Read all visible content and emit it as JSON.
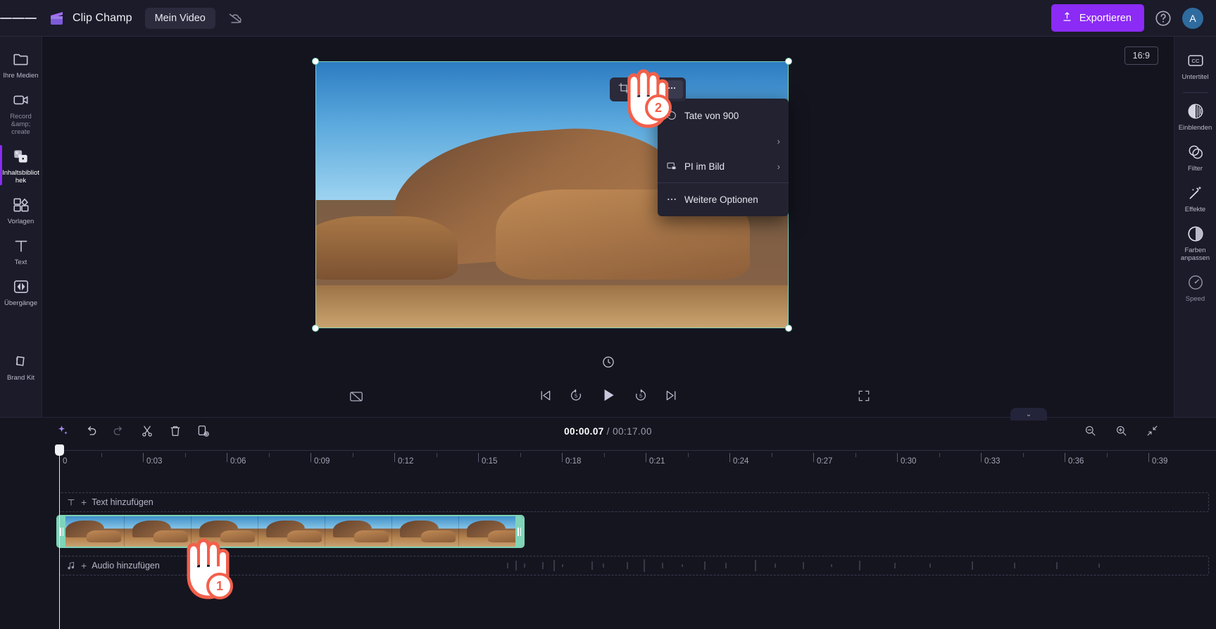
{
  "app": {
    "brand_name": "Clip Champ",
    "project_name": "Mein Video",
    "export_label": "Exportieren",
    "avatar_initial": "A",
    "accent_color": "#8B2BF5",
    "selection_color": "#7fd4b8",
    "annotation_color": "#F2604B"
  },
  "topbar": {
    "menu_icon": "hamburger-icon",
    "logo_icon": "clipchamp-logo-icon",
    "cloud_icon": "cloud-off-icon",
    "upload_icon": "upload-arrow-icon",
    "help_icon": "help-circle-icon"
  },
  "left_rail": {
    "items": [
      {
        "label": "Ihre Medien",
        "icon": "folder-icon",
        "active": false
      },
      {
        "label": "Record &amp; create",
        "icon": "video-camera-icon",
        "active": false
      },
      {
        "label": "Inhaltsbibliothek",
        "icon": "content-library-icon",
        "active": true
      },
      {
        "label": "Vorlagen",
        "icon": "templates-grid-icon",
        "active": false
      },
      {
        "label": "Text",
        "icon": "text-t-icon",
        "active": false
      },
      {
        "label": "Übergänge",
        "icon": "transitions-icon",
        "active": false
      },
      {
        "label": "Brand Kit",
        "icon": "brand-kit-icon",
        "active": false
      }
    ],
    "collapse_icon": "chevron-right-icon"
  },
  "right_rail": {
    "items": [
      {
        "label": "Untertitel",
        "icon": "closed-caption-icon"
      },
      {
        "label": "Einblenden",
        "icon": "fade-icon"
      },
      {
        "label": "Filter",
        "icon": "filter-circles-icon"
      },
      {
        "label": "Effekte",
        "icon": "magic-wand-icon"
      },
      {
        "label": "Farben anpassen",
        "icon": "contrast-circle-icon"
      },
      {
        "label": "Speed",
        "icon": "speedometer-icon"
      }
    ],
    "collapse_icon": "chevron-left-icon"
  },
  "stage": {
    "aspect_ratio": "16:9",
    "float_toolbar": [
      {
        "name": "crop-button",
        "icon": "crop-icon",
        "selected": false
      },
      {
        "name": "fit-button",
        "icon": "fit-horizontal-icon",
        "selected": false
      },
      {
        "name": "more-button",
        "icon": "ellipsis-icon",
        "selected": true
      }
    ]
  },
  "context_menu": {
    "items": [
      {
        "label": "Tate von 900",
        "icon": "rotate-icon",
        "has_submenu": false
      },
      {
        "label": "",
        "icon": "",
        "has_submenu": true
      },
      {
        "label": "PI im Bild",
        "icon": "picture-in-picture-icon",
        "has_submenu": true
      },
      {
        "label": "Weitere Optionen",
        "icon": "ellipsis-icon",
        "has_submenu": false
      }
    ],
    "chevron": "›"
  },
  "player": {
    "snapshot_icon": "snapshot-off-icon",
    "replay_icon": "replay-icon",
    "controls": [
      {
        "name": "skip-to-start-button",
        "icon": "skip-back-icon"
      },
      {
        "name": "rewind-5-button",
        "icon": "rewind-5-icon"
      },
      {
        "name": "play-button",
        "icon": "play-icon"
      },
      {
        "name": "forward-5-button",
        "icon": "forward-5-icon"
      },
      {
        "name": "skip-to-end-button",
        "icon": "skip-forward-icon"
      }
    ],
    "fullscreen_icon": "fullscreen-icon"
  },
  "timeline": {
    "current_time": "00:00.07",
    "separator": "/",
    "total_time": "00:17.00",
    "tools": [
      {
        "name": "ai-sparkle-button",
        "icon": "sparkle-icon",
        "disabled": false
      },
      {
        "name": "undo-button",
        "icon": "undo-icon",
        "disabled": false
      },
      {
        "name": "redo-button",
        "icon": "redo-icon",
        "disabled": true
      },
      {
        "name": "split-button",
        "icon": "scissors-icon",
        "disabled": false
      },
      {
        "name": "delete-button",
        "icon": "trash-icon",
        "disabled": false
      },
      {
        "name": "duplicate-button",
        "icon": "duplicate-icon",
        "disabled": false
      }
    ],
    "zoom_tools": [
      {
        "name": "zoom-out-button",
        "icon": "magnifier-minus-icon"
      },
      {
        "name": "zoom-in-button",
        "icon": "magnifier-plus-icon"
      },
      {
        "name": "fit-timeline-button",
        "icon": "collapse-arrows-icon"
      }
    ],
    "ruler_labels": [
      "0",
      "0:03",
      "0:06",
      "0:09",
      "0:12",
      "0:15",
      "0:18",
      "0:21",
      "0:24",
      "0:27",
      "0:30",
      "0:33",
      "0:36",
      "0:39"
    ],
    "tracks": [
      {
        "label": "Text hinzufügen",
        "icon": "text-t-icon",
        "plus": "+"
      },
      {
        "label": "Audio hinzufügen",
        "icon": "music-note-icon",
        "plus": "+"
      }
    ]
  },
  "annotations": [
    {
      "number": "1",
      "icon": "hand-pointer-icon"
    },
    {
      "number": "2",
      "icon": "hand-pointer-icon"
    }
  ]
}
